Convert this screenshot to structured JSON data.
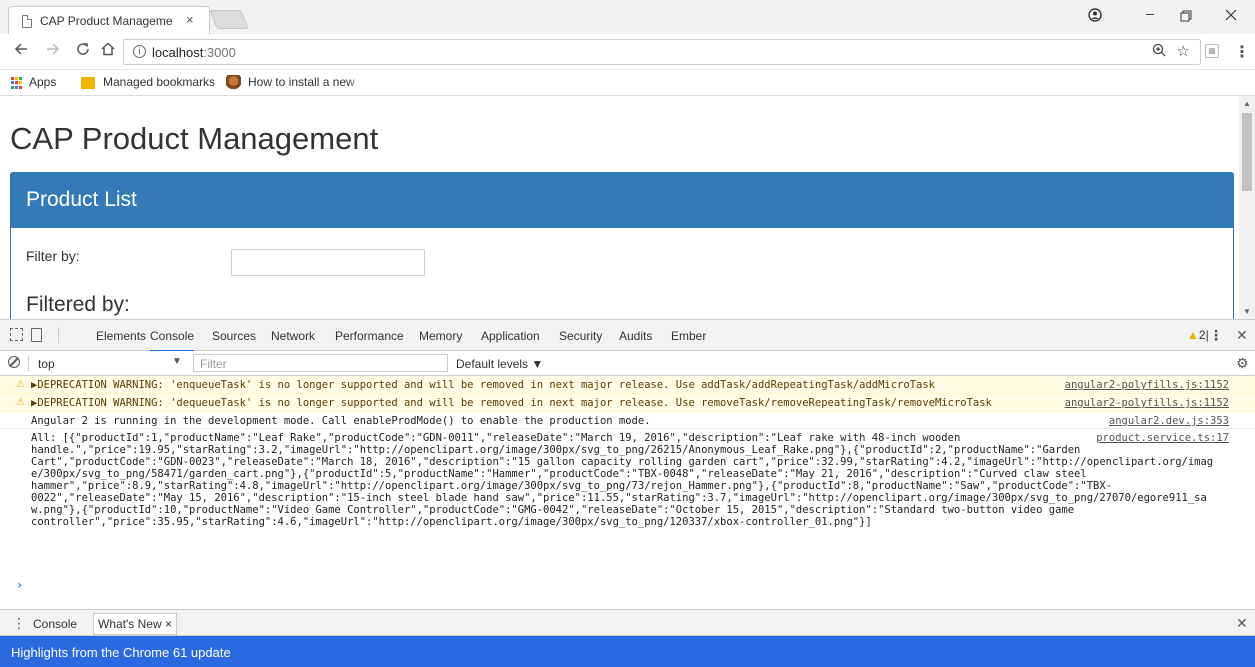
{
  "browser": {
    "tab_title": "CAP Product Manageme",
    "tab_close": "×",
    "address_host": "localhost",
    "address_port": ":3000",
    "info_glyph": "i",
    "bookmarks": [
      {
        "label": "Apps"
      },
      {
        "label": "Managed bookmarks"
      },
      {
        "label": "How to install a new"
      }
    ],
    "apps_colors": [
      "#ea4335",
      "#fbbc05",
      "#34a853",
      "#4285f4",
      "#ea4335",
      "#fbbc05",
      "#34a853",
      "#4285f4",
      "#ea4335"
    ]
  },
  "page": {
    "title": "CAP Product Management",
    "panel_title": "Product List",
    "filter_label": "Filter by:",
    "filtered_by": "Filtered by:"
  },
  "devtools": {
    "tabs": [
      "Elements",
      "Console",
      "Sources",
      "Network",
      "Performance",
      "Memory",
      "Application",
      "Security",
      "Audits",
      "Ember"
    ],
    "active_tab": "Console",
    "warning_count": "2",
    "context": "top",
    "filter_placeholder": "Filter",
    "levels_label": "Default levels ▼",
    "messages": [
      {
        "level": "warning",
        "text": "▶DEPRECATION WARNING: 'enqueueTask' is no longer supported and will be removed in next major release. Use addTask/addRepeatingTask/addMicroTask",
        "source": "angular2-polyfills.js:1152"
      },
      {
        "level": "warning",
        "text": "▶DEPRECATION WARNING: 'dequeueTask' is no longer supported and will be removed in next major release. Use removeTask/removeRepeatingTask/removeMicroTask",
        "source": "angular2-polyfills.js:1152"
      },
      {
        "level": "info",
        "text": "Angular 2 is running in the development mode. Call enableProdMode() to enable the production mode.",
        "source": "angular2.dev.js:353"
      }
    ],
    "log_source": "product.service.ts:17",
    "log_lines": [
      "All: [{\"productId\":1,\"productName\":\"Leaf Rake\",\"productCode\":\"GDN-0011\",\"releaseDate\":\"March 19, 2016\",\"description\":\"Leaf rake with 48-inch wooden",
      "handle.\",\"price\":19.95,\"starRating\":3.2,\"imageUrl\":\"http://openclipart.org/image/300px/svg_to_png/26215/Anonymous_Leaf_Rake.png\"},{\"productId\":2,\"productName\":\"Garden",
      "Cart\",\"productCode\":\"GDN-0023\",\"releaseDate\":\"March 18, 2016\",\"description\":\"15 gallon capacity rolling garden cart\",\"price\":32.99,\"starRating\":4.2,\"imageUrl\":\"http://openclipart.org/imag",
      "e/300px/svg_to_png/58471/garden_cart.png\"},{\"productId\":5,\"productName\":\"Hammer\",\"productCode\":\"TBX-0048\",\"releaseDate\":\"May 21, 2016\",\"description\":\"Curved claw steel",
      "hammer\",\"price\":8.9,\"starRating\":4.8,\"imageUrl\":\"http://openclipart.org/image/300px/svg_to_png/73/rejon_Hammer.png\"},{\"productId\":8,\"productName\":\"Saw\",\"productCode\":\"TBX-",
      "0022\",\"releaseDate\":\"May 15, 2016\",\"description\":\"15-inch steel blade hand saw\",\"price\":11.55,\"starRating\":3.7,\"imageUrl\":\"http://openclipart.org/image/300px/svg_to_png/27070/egore911_sa",
      "w.png\"},{\"productId\":10,\"productName\":\"Video Game Controller\",\"productCode\":\"GMG-0042\",\"releaseDate\":\"October 15, 2015\",\"description\":\"Standard two-button video game",
      "controller\",\"price\":35.95,\"starRating\":4.6,\"imageUrl\":\"http://openclipart.org/image/300px/svg_to_png/120337/xbox-controller_01.png\"}]"
    ],
    "prompt_glyph": "›",
    "drawer_tabs": [
      "Console",
      "What's New"
    ],
    "drawer_active": "What's New",
    "highlights": "Highlights from the Chrome 61 update"
  }
}
